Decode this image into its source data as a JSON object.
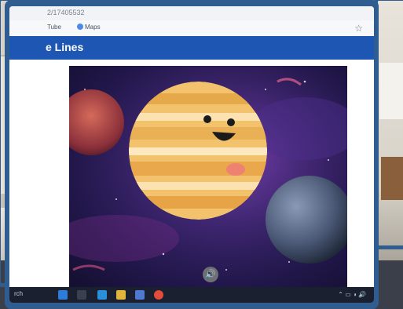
{
  "browser": {
    "address_fragment": "2/17405532",
    "bookmarks": [
      "Tube",
      "Maps"
    ]
  },
  "page": {
    "banner_title": "e Lines"
  },
  "taskbar": {
    "search_fragment": "rch"
  },
  "colors": {
    "frame": "#2f5d90",
    "banner": "#1e56b4",
    "planet": "#f2c36c",
    "space": "#2a1d5c"
  }
}
